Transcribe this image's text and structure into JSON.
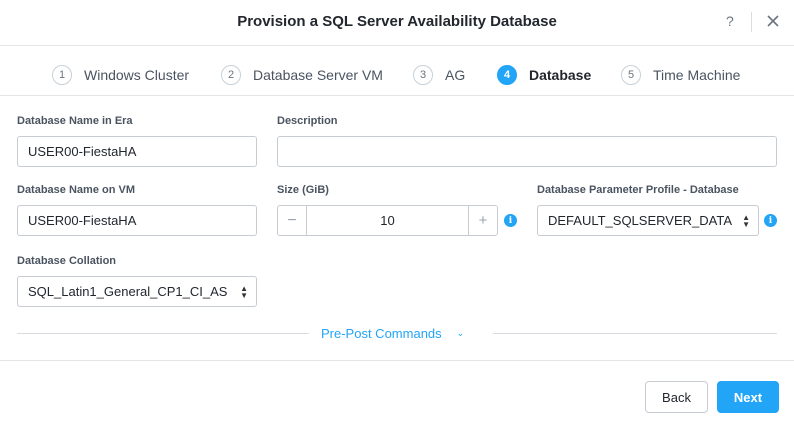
{
  "dialog": {
    "title": "Provision a SQL Server Availability Database",
    "help_label": "?"
  },
  "steps": [
    {
      "num": "1",
      "label": "Windows Cluster"
    },
    {
      "num": "2",
      "label": "Database Server VM"
    },
    {
      "num": "3",
      "label": "AG"
    },
    {
      "num": "4",
      "label": "Database"
    },
    {
      "num": "5",
      "label": "Time Machine"
    }
  ],
  "active_step": 4,
  "form": {
    "db_name_era": {
      "label": "Database Name in Era",
      "value": "USER00-FiestaHA"
    },
    "description": {
      "label": "Description",
      "value": ""
    },
    "db_name_vm": {
      "label": "Database Name on VM",
      "value": "USER00-FiestaHA"
    },
    "size": {
      "label": "Size (GiB)",
      "value": "10",
      "minus": "−",
      "plus": "+"
    },
    "param_profile": {
      "label": "Database Parameter Profile - Database",
      "value": "DEFAULT_SQLSERVER_DATA"
    },
    "collation": {
      "label": "Database Collation",
      "value": "SQL_Latin1_General_CP1_CI_AS"
    }
  },
  "prepost": {
    "label": "Pre-Post Commands",
    "chevron": "⌄"
  },
  "footer": {
    "back_label": "Back",
    "next_label": "Next"
  },
  "colors": {
    "accent": "#22a5f7",
    "border": "#c7ccd2",
    "text": "#22272e"
  },
  "icons": {
    "info": "info-icon",
    "close": "close-icon",
    "help": "help-icon",
    "select": "select-arrows-icon"
  }
}
